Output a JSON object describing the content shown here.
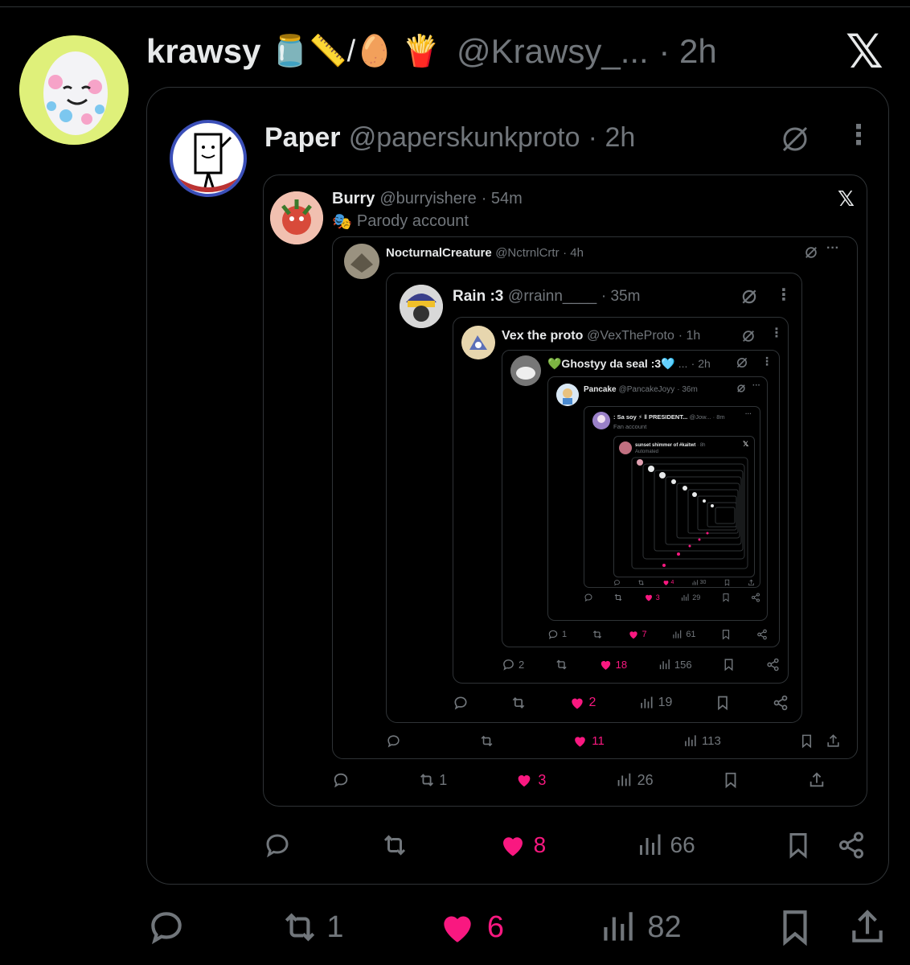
{
  "top": {
    "name": "krawsy",
    "emoji": "🫙📏/🥚 🍟",
    "handle": "@Krawsy_...",
    "time": "· 2h",
    "x_logo": "𝕏",
    "actions": {
      "reply": "",
      "retweet": "1",
      "like": "6",
      "views": "82"
    }
  },
  "l1": {
    "name": "Paper",
    "handle": "@paperskunkproto",
    "time": "· 2h",
    "actions": {
      "reply": "",
      "retweet": "",
      "like": "8",
      "views": "66"
    }
  },
  "l2": {
    "name": "Burry",
    "handle": "@burryishere",
    "time": "· 54m",
    "sub": "Parody account",
    "x_logo": "𝕏",
    "actions": {
      "reply": "",
      "retweet": "1",
      "like": "3",
      "views": "26"
    }
  },
  "l3": {
    "name": "NocturnalCreature",
    "handle": "@NctrnlCrtr",
    "time": "· 4h",
    "actions": {
      "reply": "",
      "retweet": "",
      "like": "11",
      "views": "113"
    }
  },
  "l4": {
    "name": "Rain :3",
    "handle": "@rrainn____",
    "time": "· 35m",
    "actions": {
      "reply": "",
      "retweet": "",
      "like": "2",
      "views": "19"
    }
  },
  "l5": {
    "name": "Vex the proto",
    "handle": "@VexTheProto",
    "time": "· 1h",
    "actions": {
      "reply": "2",
      "retweet": "",
      "like": "18",
      "views": "156"
    }
  },
  "l6": {
    "name": "💚Ghostyy da seal :3🩵",
    "handle": "...",
    "time": "· 2h",
    "actions": {
      "reply": "1",
      "retweet": "",
      "like": "7",
      "views": "61"
    }
  },
  "l7": {
    "name": "Pancake",
    "handle": "@PancakeJoyy",
    "time": "· 36m",
    "actions": {
      "reply": "",
      "retweet": "",
      "like": "3",
      "views": "29"
    }
  },
  "l8": {
    "name": ": Sa soy ⚡ ‖ PRESIDENT...",
    "handle": "@Jow...",
    "time": "· 8m",
    "sub": "Fan account",
    "actions": {
      "reply": "",
      "retweet": "",
      "like": "4",
      "views": "30"
    }
  },
  "l9": {
    "name": "sunset shimmer of #kaitwt",
    "handle": "",
    "time": "· 8h",
    "sub": "Automated"
  },
  "colors": {
    "background": "#000000",
    "border": "#2f3336",
    "text": "#e7e9ea",
    "secondary": "#71767b",
    "like": "#f91880"
  }
}
